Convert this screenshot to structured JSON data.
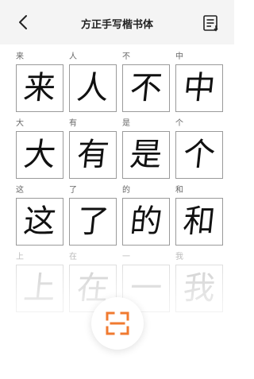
{
  "header": {
    "title": "方正手写楷书体",
    "back_icon": "back-arrow-icon",
    "list_icon": "list-icon"
  },
  "characters": [
    {
      "label": "来",
      "char": "来"
    },
    {
      "label": "人",
      "char": "人"
    },
    {
      "label": "不",
      "char": "不"
    },
    {
      "label": "中",
      "char": "中"
    },
    {
      "label": "大",
      "char": "大"
    },
    {
      "label": "有",
      "char": "有"
    },
    {
      "label": "是",
      "char": "是"
    },
    {
      "label": "个",
      "char": "个"
    },
    {
      "label": "这",
      "char": "这"
    },
    {
      "label": "了",
      "char": "了"
    },
    {
      "label": "的",
      "char": "的"
    },
    {
      "label": "和",
      "char": "和"
    },
    {
      "label": "上",
      "char": "上"
    },
    {
      "label": "在",
      "char": "在"
    },
    {
      "label": "一",
      "char": "一"
    },
    {
      "label": "我",
      "char": "我"
    }
  ],
  "scan_button": {
    "icon": "scan-frame-icon",
    "accent_color": "#f07a30"
  }
}
